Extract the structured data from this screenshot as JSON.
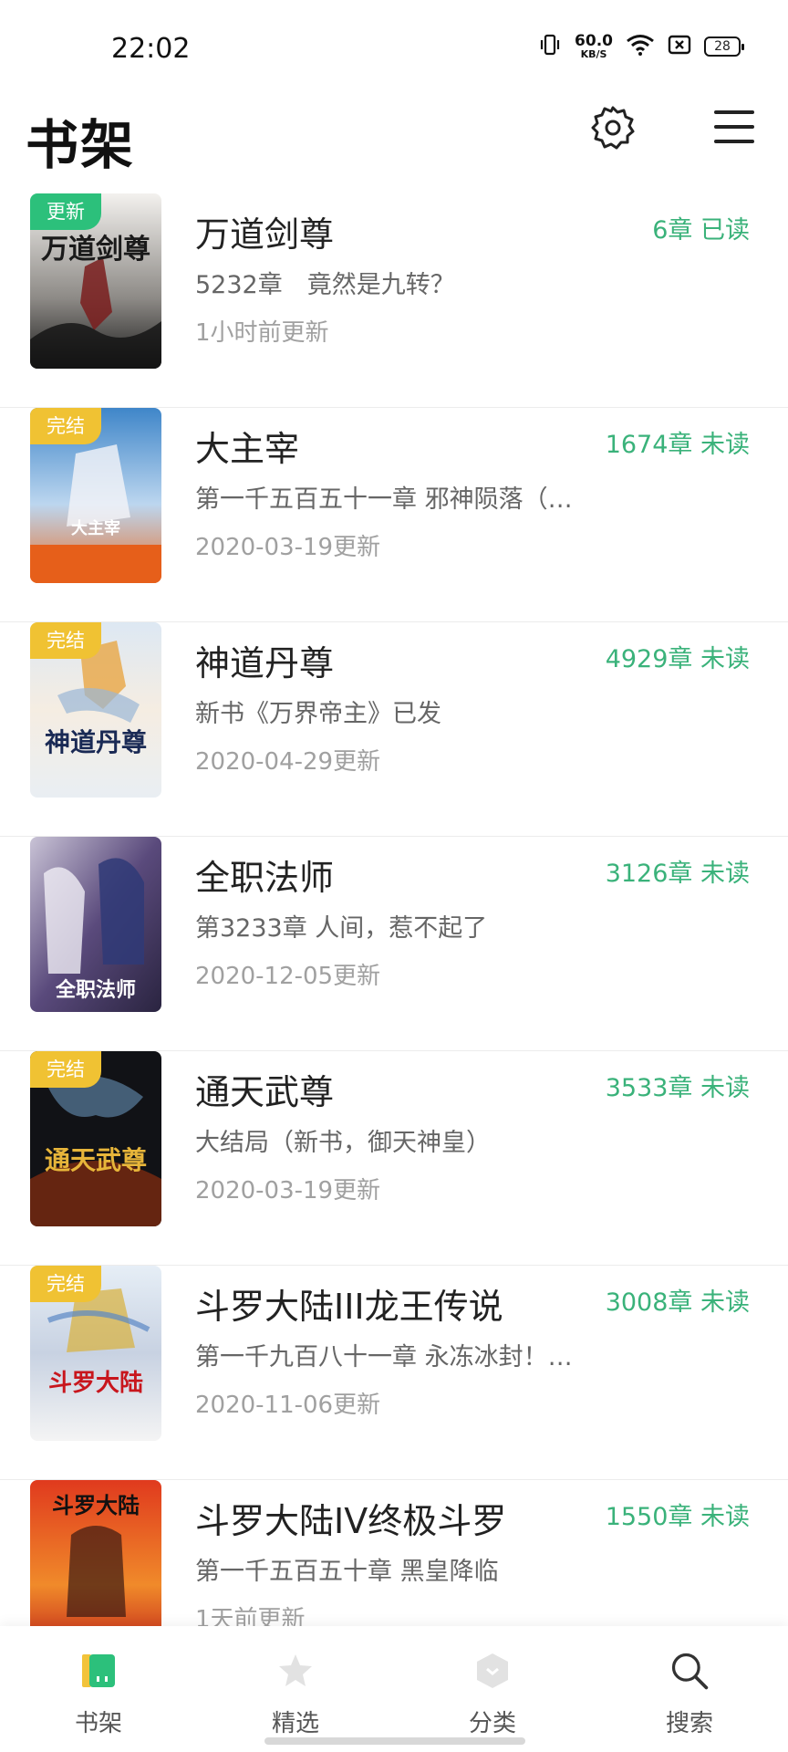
{
  "status_bar": {
    "time": "22:02",
    "net_speed_value": "60.0",
    "net_speed_unit": "KB/S",
    "battery": "28",
    "icons": [
      "vibrate-icon",
      "wifi-icon",
      "sim-off-icon",
      "battery-icon"
    ]
  },
  "header": {
    "title": "书架",
    "icons": [
      "gear-icon",
      "menu-icon"
    ]
  },
  "colors": {
    "accent_green": "#3ab27a",
    "badge_green": "#2cc07b",
    "badge_yellow": "#f0c233"
  },
  "books": [
    {
      "title": "万道剑尊",
      "badge": "更新",
      "chapter": "5232章　竟然是九转？",
      "updated": "1小时前更新",
      "count": "6章 已读",
      "cover_text": "万道剑尊"
    },
    {
      "title": "大主宰",
      "badge": "完结",
      "chapter": "第一千五百五十一章 邪神陨落（…",
      "updated": "2020-03-19更新",
      "count": "1674章 未读",
      "cover_text": "大主宰"
    },
    {
      "title": "神道丹尊",
      "badge": "完结",
      "chapter": "新书《万界帝主》已发",
      "updated": "2020-04-29更新",
      "count": "4929章 未读",
      "cover_text": "神道丹尊"
    },
    {
      "title": "全职法师",
      "badge": "",
      "chapter": "第3233章 人间，惹不起了",
      "updated": "2020-12-05更新",
      "count": "3126章 未读",
      "cover_text": "全职法师"
    },
    {
      "title": "通天武尊",
      "badge": "完结",
      "chapter": "大结局（新书，御天神皇）",
      "updated": "2020-03-19更新",
      "count": "3533章 未读",
      "cover_text": "通天武尊"
    },
    {
      "title": "斗罗大陆III龙王传说",
      "badge": "完结",
      "chapter": "第一千九百八十一章 永冻冰封！…",
      "updated": "2020-11-06更新",
      "count": "3008章 未读",
      "cover_text": "斗罗大陆"
    },
    {
      "title": "斗罗大陆IV终极斗罗",
      "badge": "",
      "chapter": "第一千五百五十章 黑皇降临",
      "updated": "1天前更新",
      "count": "1550章 未读",
      "cover_text": "斗罗大陆"
    }
  ],
  "bottom_nav": [
    {
      "label": "书架",
      "icon": "bookshelf-icon",
      "active": true
    },
    {
      "label": "精选",
      "icon": "star-icon",
      "active": false
    },
    {
      "label": "分类",
      "icon": "category-icon",
      "active": false
    },
    {
      "label": "搜索",
      "icon": "search-icon",
      "active": false
    }
  ]
}
